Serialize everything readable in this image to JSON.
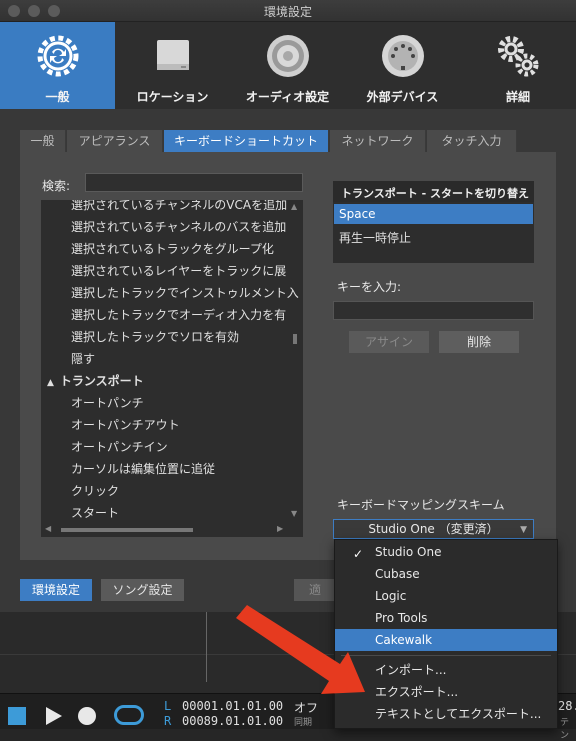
{
  "window": {
    "title": "環境設定"
  },
  "toolbar": {
    "items": [
      {
        "label": "一般",
        "icon": "gear-cycle-icon"
      },
      {
        "label": "ロケーション",
        "icon": "drive-icon"
      },
      {
        "label": "オーディオ設定",
        "icon": "speaker-icon"
      },
      {
        "label": "外部デバイス",
        "icon": "midi-port-icon"
      },
      {
        "label": "詳細",
        "icon": "gears-icon"
      }
    ]
  },
  "tabs": [
    "一般",
    "アピアランス",
    "キーボードショートカット",
    "ネットワーク",
    "タッチ入力"
  ],
  "search": {
    "label": "検索:",
    "value": ""
  },
  "commands": {
    "rows": [
      "選択されているチャンネルのVCAを追加",
      "選択されているチャンネルのバスを追加",
      "選択されているトラックをグループ化",
      "選択されているレイヤーをトラックに展",
      "選択したトラックでインストゥルメント入",
      "選択したトラックでオーディオ入力を有",
      "選択したトラックでソロを有効",
      "隠す"
    ],
    "group_label": "トランスポート",
    "group_rows": [
      "オートパンチ",
      "オートパンチアウト",
      "オートパンチイン",
      "カーソルは編集位置に追従",
      "クリック",
      "スタート"
    ]
  },
  "command_detail": {
    "title": "トランスポート - スタートを切り替え",
    "keys": [
      "Space",
      "再生一時停止"
    ]
  },
  "key_input": {
    "label": "キーを入力:",
    "value": ""
  },
  "buttons": {
    "assign": "アサイン",
    "delete": "削除",
    "preferences": "環境設定",
    "song_settings": "ソング設定",
    "hidden": "適"
  },
  "scheme": {
    "label": "キーボードマッピングスキーム",
    "value": "Studio One （変更済）"
  },
  "menu": {
    "schemes": [
      "Studio One",
      "Cubase",
      "Logic",
      "Pro Tools",
      "Cakewalk"
    ],
    "checked": "Studio One",
    "highlighted": "Cakewalk",
    "actions": [
      "インポート...",
      "エクスポート...",
      "テキストとしてエクスポート..."
    ]
  },
  "transport": {
    "pos_l_label": "L",
    "pos_r_label": "R",
    "pos_l": "00001.01.01.00",
    "pos_r": "00089.01.01.00",
    "off": "オフ",
    "sync": "同期",
    "right_value": "28.",
    "right_sub": "テン"
  },
  "colors": {
    "accent": "#3d7dc4",
    "arrow": "#e63a1f"
  }
}
